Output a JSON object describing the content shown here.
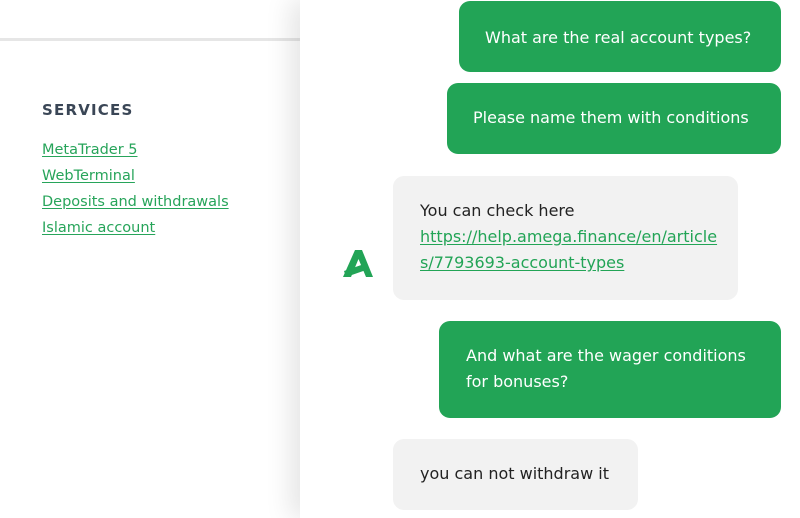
{
  "site": {
    "services": {
      "heading": "SERVICES",
      "links": [
        "MetaTrader 5",
        "WebTerminal",
        "Deposits and withdrawals",
        "Islamic account"
      ]
    }
  },
  "chat": {
    "accent_color": "#22a456",
    "bot_avatar_icon": "amega-logo-icon",
    "messages": [
      {
        "sender": "user",
        "text": "What are the real account types?"
      },
      {
        "sender": "user",
        "text": "Please name them with conditions"
      },
      {
        "sender": "bot",
        "text": "You can check here",
        "link": "https://help.amega.finance/en/articles/7793693-account-types"
      },
      {
        "sender": "user",
        "text": "And what are the wager conditions for bonuses?"
      },
      {
        "sender": "bot",
        "text": "you can not withdraw it"
      }
    ]
  }
}
